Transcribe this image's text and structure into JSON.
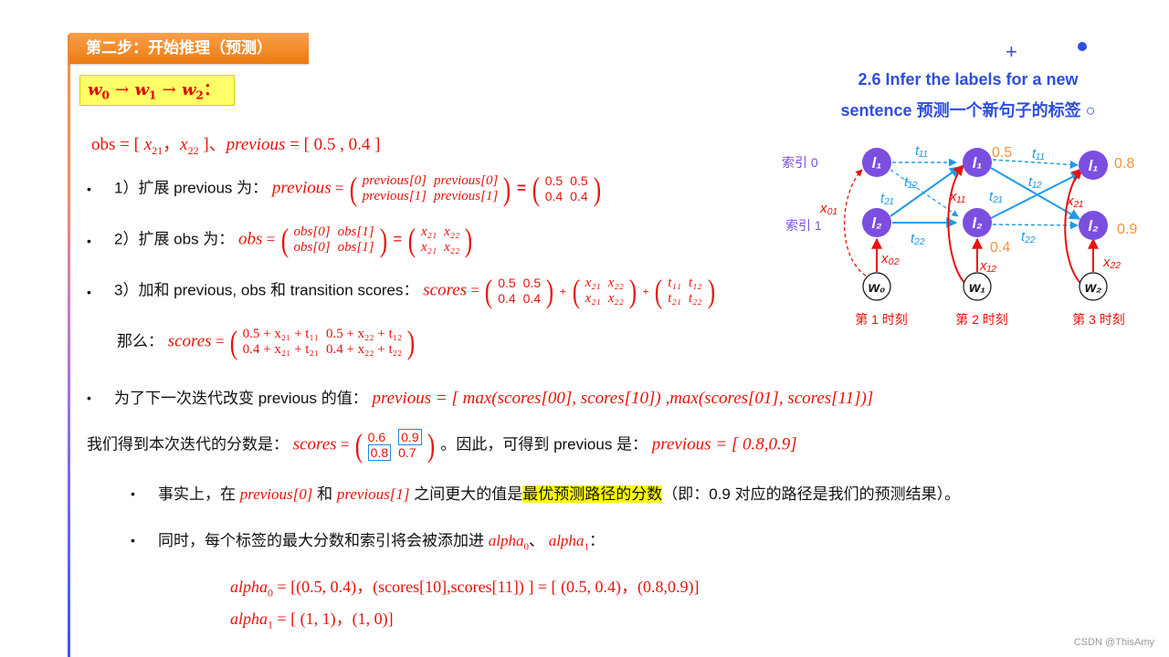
{
  "header": {
    "step_title": "第二步：开始推理（预测）"
  },
  "sequence": {
    "w0": "w",
    "w0_sub": "0",
    "w1": "w",
    "w1_sub": "1",
    "w2": "w",
    "w2_sub": "2",
    "arrow": "→",
    "colon": "："
  },
  "obs_line": {
    "text_obs": "obs = [ ",
    "x21": "x",
    "x21_sub": "21",
    "sep": "，",
    "x22": "x",
    "x22_sub": "22",
    "close": " ]、",
    "previous": "previous",
    "eq_prev": " = [ 0.5 , 0.4 ]"
  },
  "steps": [
    {
      "bullet": "•",
      "label": "1）扩展 previous 为：",
      "lhs": "previous",
      "eq": " = ",
      "matrix1": [
        [
          "previous[0]",
          "previous[0]"
        ],
        [
          "previous[1]",
          "previous[1]"
        ]
      ],
      "eq2": "=",
      "matrix2": [
        [
          "0.5",
          "0.5"
        ],
        [
          "0.4",
          "0.4"
        ]
      ]
    },
    {
      "bullet": "•",
      "label": "2）扩展 obs 为：",
      "lhs": "obs",
      "eq": " = ",
      "matrix1": [
        [
          "obs[0]",
          "obs[1]"
        ],
        [
          "obs[0]",
          "obs[1]"
        ]
      ],
      "eq2": "=",
      "matrix2": [
        [
          "x₂₁",
          "x₂₂"
        ],
        [
          "x₂₁",
          "x₂₂"
        ]
      ]
    },
    {
      "bullet": "•",
      "label": "3）加和 previous, obs 和 transition scores：",
      "lhs": "scores",
      "eq": " = ",
      "matrix1": [
        [
          "0.5",
          "0.5"
        ],
        [
          "0.4",
          "0.4"
        ]
      ],
      "plus1": "+",
      "matrix2": [
        [
          "x₂₁",
          "x₂₂"
        ],
        [
          "x₂₁",
          "x₂₂"
        ]
      ],
      "plus2": "+",
      "matrix3": [
        [
          "t₁₁",
          "t₁₂"
        ],
        [
          "t₂₁",
          "t₂₂"
        ]
      ]
    }
  ],
  "then_line": {
    "label": "那么：",
    "lhs": "scores",
    "eq": " = ",
    "matrix": [
      [
        "0.5 + x₂₁ + t₁₁",
        "0.5 + x₂₂ + t₁₂"
      ],
      [
        "0.4 + x₂₁ + t₂₁",
        "0.4 + x₂₂ + t₂₂"
      ]
    ]
  },
  "update_line": {
    "bullet": "•",
    "label": "为了下一次迭代改变 previous 的值：",
    "formula": "previous = [ max(scores[00], scores[10]) ,max(scores[01], scores[11])]"
  },
  "result_line": {
    "label": "我们得到本次迭代的分数是：",
    "lhs": "scores",
    "eq": " = ",
    "matrix": [
      [
        "0.6",
        "0.9"
      ],
      [
        "0.8",
        "0.7"
      ]
    ],
    "boxed_cells": [
      "0.9",
      "0.8"
    ],
    "mid": "。因此，可得到 previous 是：",
    "formula": "previous = [ 0.8,0.9]"
  },
  "fact_line": {
    "bullet": "•",
    "t1": "事实上，在 ",
    "p0": "previous[0]",
    "t2": " 和 ",
    "p1": "previous[1]",
    "t3": " 之间更大的值是",
    "highlight": "最优预测路径的分数",
    "t4": "（即：0.9 对应的路径是我们的预测结果）。"
  },
  "alpha_line": {
    "bullet": "•",
    "t1": "同时，每个标签的最大分数和索引将会被添加进 ",
    "a0": "alpha",
    "a0_sub": "0",
    "sep": "、 ",
    "a1": "alpha",
    "a1_sub": "1",
    "colon": "："
  },
  "alpha0": {
    "name": "alpha",
    "sub": "0",
    "formula": " = [(0.5, 0.4)，(scores[10],scores[11]) ] = [ (0.5, 0.4)，(0.8,0.9)]"
  },
  "alpha1": {
    "name": "alpha",
    "sub": "1",
    "formula": " = [ (1, 1)，(1, 0)]"
  },
  "slide_title": {
    "line1": "2.6 Infer the labels for a new",
    "line2": "sentence 预测一个新句子的标签",
    "bullet_circle": "○"
  },
  "diagram": {
    "index_labels": [
      "索引 0",
      "索引 1"
    ],
    "label_nodes": [
      "l₁",
      "l₂"
    ],
    "word_nodes": [
      "w₀",
      "w₁",
      "w₂"
    ],
    "time_labels": [
      "第 1 时刻",
      "第 2 时刻",
      "第 3 时刻"
    ],
    "transitions": [
      "t₁₁",
      "t₁₂",
      "t₂₁",
      "t₂₂"
    ],
    "emissions": [
      "x₀₁",
      "x₀₂",
      "x₁₁",
      "x₁₂",
      "x₂₁",
      "x₂₂"
    ],
    "scores_t2": [
      "0.5",
      "0.4"
    ],
    "scores_t3": [
      "0.8",
      "0.9"
    ],
    "colors": {
      "node": "#7b4ee0",
      "transition": "#1e9be8",
      "emission": "#e8120c",
      "score": "#f7913a",
      "index": "#7b4ee0"
    }
  },
  "watermark": "CSDN @ThisAmy"
}
